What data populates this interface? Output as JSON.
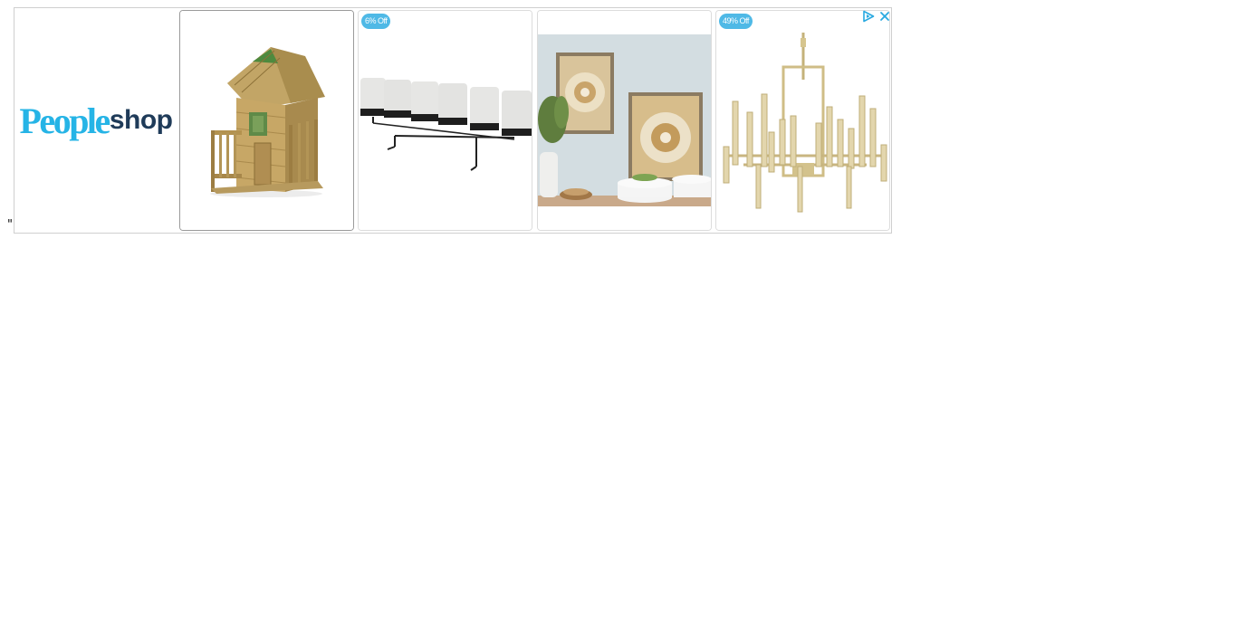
{
  "page": {
    "stray_text": "\""
  },
  "ad": {
    "brand": {
      "part1": "People",
      "part2": "shop"
    },
    "products": [
      {
        "name": "wooden-playhouse",
        "badge": ""
      },
      {
        "name": "pillar-candle-holder",
        "badge": "6% Off"
      },
      {
        "name": "framed-wall-art-set",
        "badge": ""
      },
      {
        "name": "brass-chandelier",
        "badge": "49% Off"
      }
    ],
    "icons": {
      "info": "adchoices-triangle-icon",
      "close": "close-x-icon"
    },
    "colors": {
      "brand_blue": "#26b4e6",
      "brand_navy": "#1f3b59",
      "badge": "#4fb9e6",
      "adchoices": "#29a9e0"
    }
  }
}
